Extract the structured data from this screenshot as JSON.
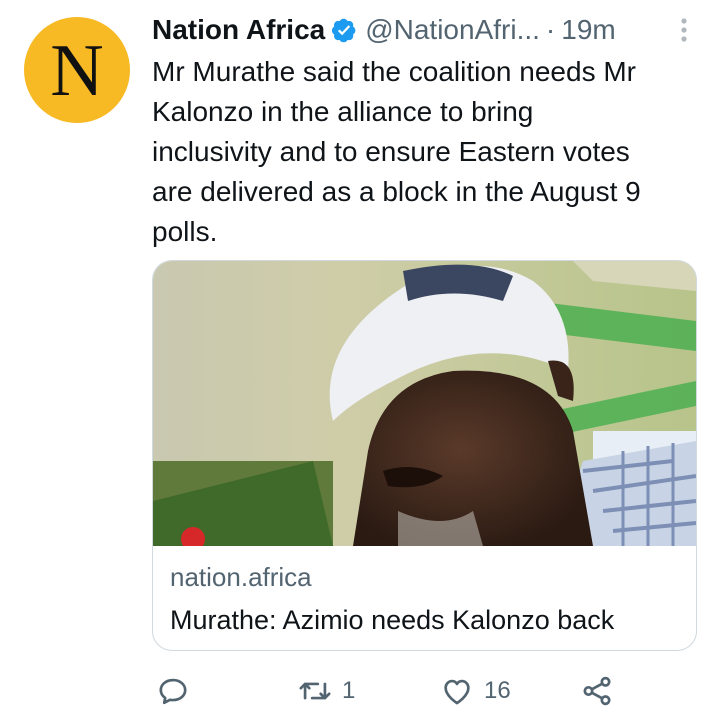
{
  "avatar": {
    "letter": "N",
    "color": "#f7b924"
  },
  "header": {
    "name": "Nation Africa",
    "handle": "@NationAfri...",
    "separator": "·",
    "time": "19m",
    "verified_icon": "verified-badge-icon",
    "more_icon": "more-vertical-icon"
  },
  "tweet": {
    "text_lines": [
      "Mr Murathe said the coalition needs Mr",
      "Kalonzo in the alliance to bring",
      "inclusivity and to ensure Eastern votes",
      "are delivered as a block in the August 9",
      "polls."
    ]
  },
  "card": {
    "image": "photo-of-man-in-cap",
    "domain": "nation.africa",
    "title": "Murathe: Azimio needs Kalonzo back"
  },
  "actions": {
    "reply": {
      "icon": "reply-icon",
      "count": ""
    },
    "retweet": {
      "icon": "retweet-icon",
      "count": "1"
    },
    "like": {
      "icon": "heart-icon",
      "count": "16"
    },
    "share": {
      "icon": "share-icon"
    }
  },
  "colors": {
    "accent": "#1d9bf0",
    "text": "#0f1419",
    "muted": "#536471",
    "border": "#cfd9de"
  }
}
